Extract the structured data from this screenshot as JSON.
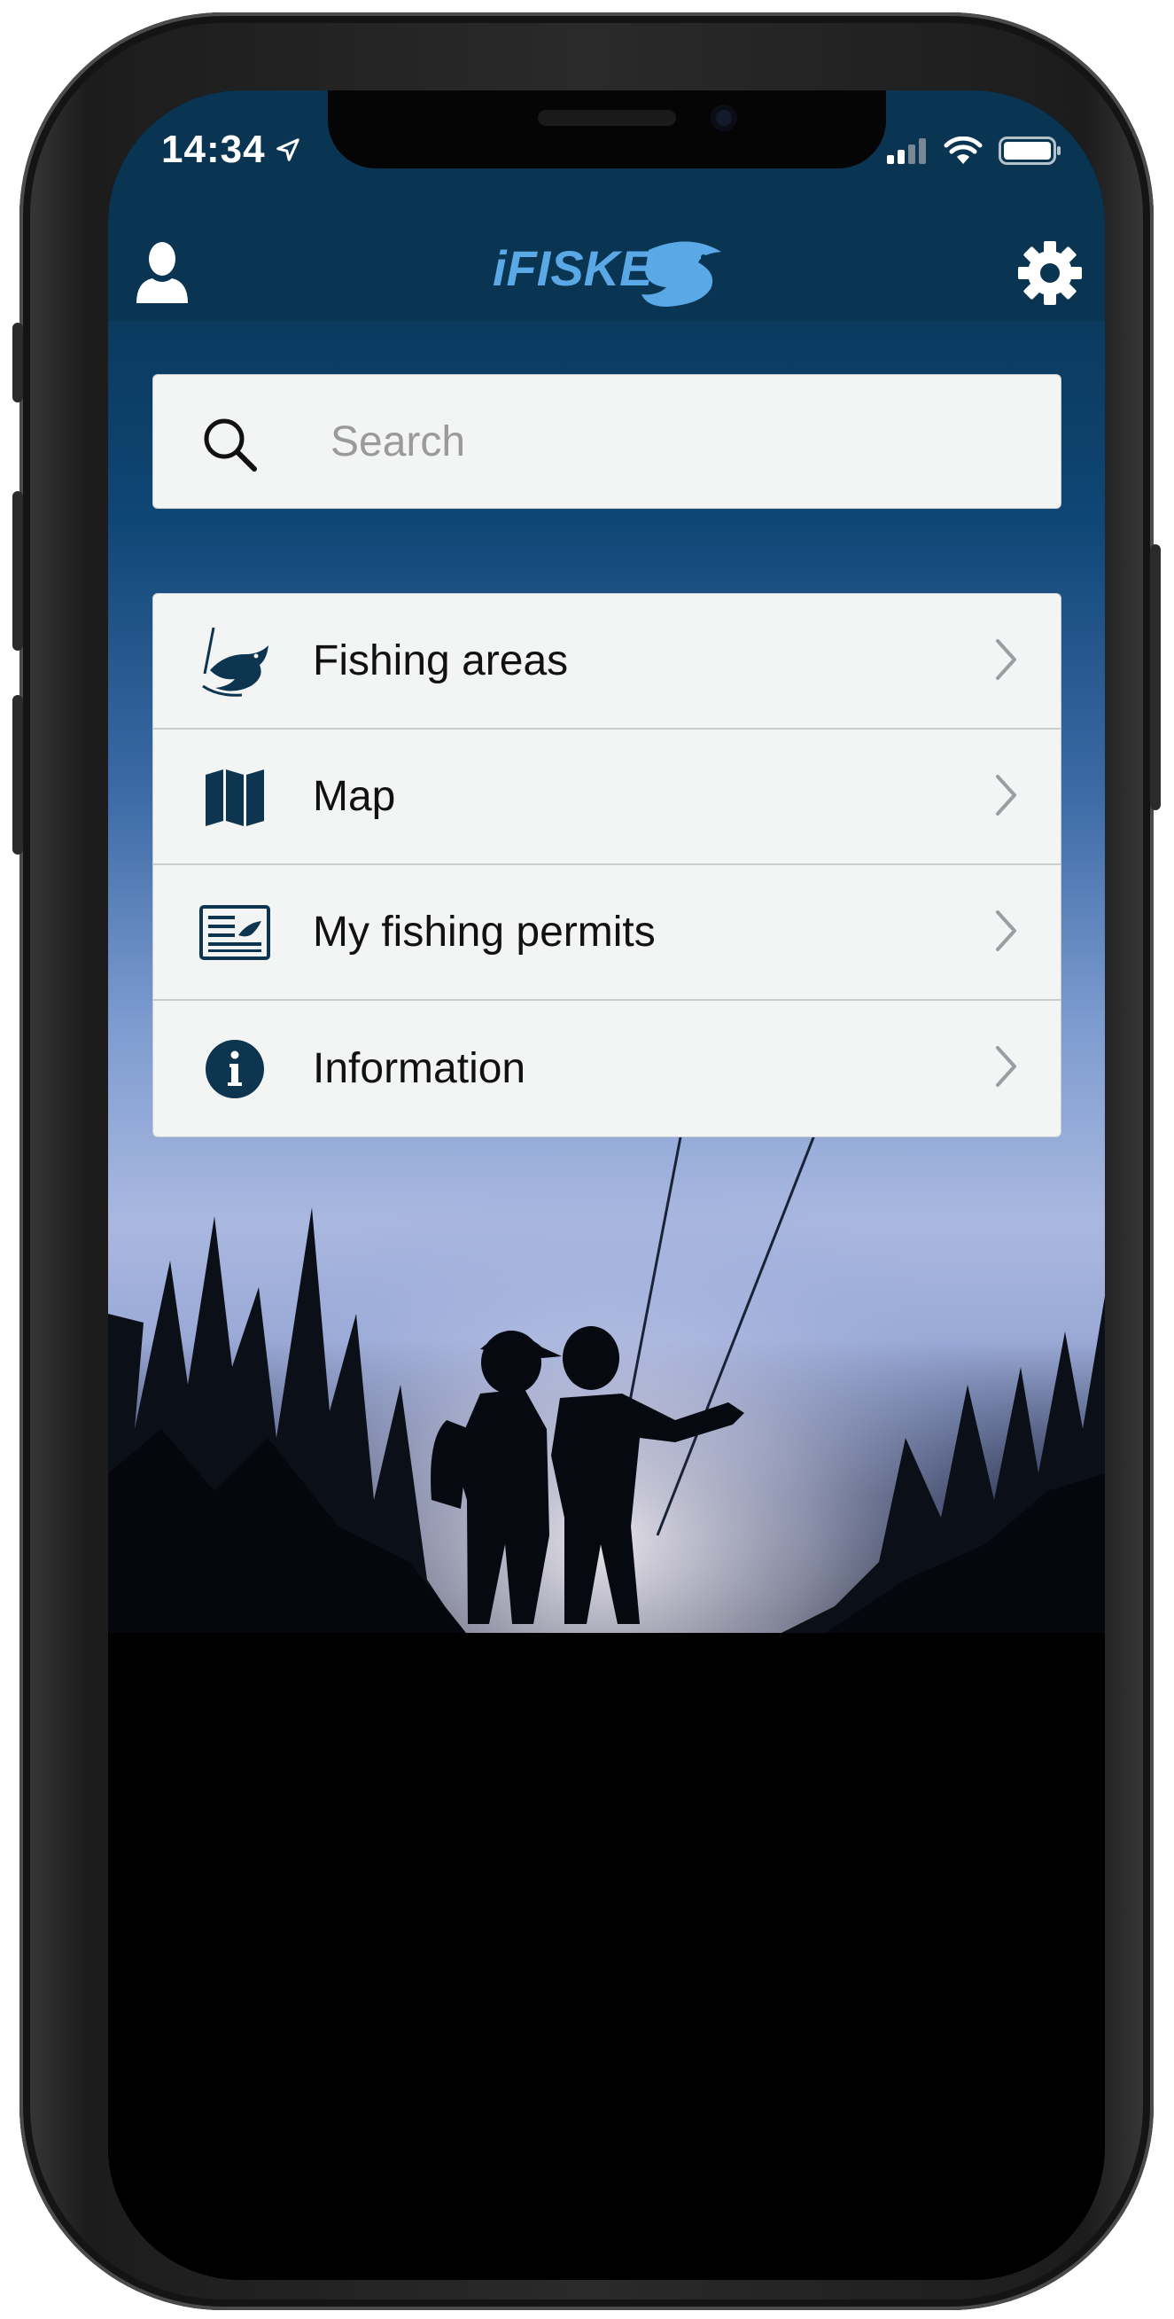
{
  "status_bar": {
    "time": "14:34"
  },
  "header": {
    "logo_text": "iFISKE"
  },
  "search": {
    "placeholder": "Search"
  },
  "menu": {
    "items": [
      {
        "label": "Fishing areas",
        "icon": "fish-rod-icon"
      },
      {
        "label": "Map",
        "icon": "map-icon"
      },
      {
        "label": "My fishing permits",
        "icon": "permit-card-icon"
      },
      {
        "label": "Information",
        "icon": "info-icon"
      }
    ]
  },
  "colors": {
    "header_bg": "#0a3552",
    "logo_blue": "#5aa8e6",
    "icon_dark": "#0d3550",
    "panel_bg": "#f3f4f4"
  }
}
